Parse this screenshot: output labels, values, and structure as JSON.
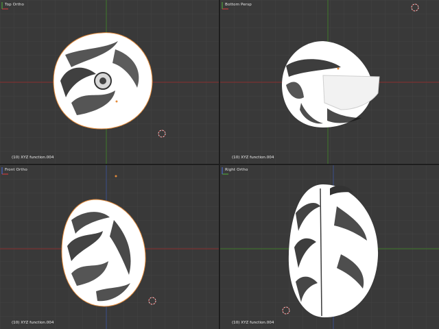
{
  "viewports": {
    "top_left": {
      "title": "Top Ortho",
      "info": "(10) XYZ function.004"
    },
    "top_right": {
      "title": "Bottom Persp",
      "info": "(10) XYZ function.004"
    },
    "bottom_left": {
      "title": "Front Ortho",
      "info": "(10) XYZ function.004"
    },
    "bottom_right": {
      "title": "Right Ortho",
      "info": "(10) XYZ function.004"
    }
  },
  "colors": {
    "background": "#393939",
    "grid": "#444444",
    "x_axis": "#8a2f2f",
    "y_axis": "#3f7a2b",
    "z_axis": "#3b4f8c",
    "selection_outline": "#e38a3a",
    "mesh": "#ffffff"
  },
  "icons": {
    "cursor": "3d-cursor-icon",
    "axes": "axis-gizmo-icon"
  }
}
